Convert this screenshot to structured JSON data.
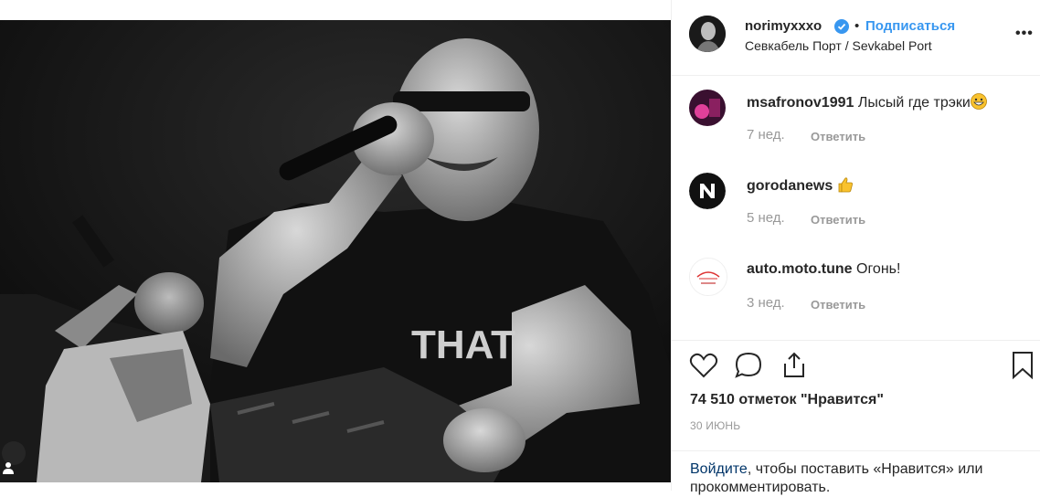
{
  "header": {
    "username": "norimyxxxo",
    "dot": "•",
    "follow_label": "Подписаться",
    "location": "Севкабель Порт / Sevkabel Port",
    "more_label": "•••"
  },
  "comments": [
    {
      "user": "msafronov1991",
      "text": "Лысый где трэки",
      "emoji": "grinning-face-icon",
      "age": "7 нед.",
      "reply": "Ответить"
    },
    {
      "user": "gorodanews",
      "text": "",
      "emoji": "thumbs-up-icon",
      "age": "5 нед.",
      "reply": "Ответить"
    },
    {
      "user": "auto.moto.tune",
      "text": "Огонь!",
      "emoji": "",
      "age": "3 нед.",
      "reply": "Ответить"
    }
  ],
  "actions": {
    "icons": [
      "heart-icon",
      "comment-icon",
      "share-icon",
      "bookmark-icon"
    ]
  },
  "likes": "74 510 отметок \"Нравится\"",
  "date": "30 ИЮНЬ",
  "login": {
    "link": "Войдите",
    "text": ", чтобы поставить «Нравится» или прокомментировать."
  },
  "colors": {
    "accent": "#3897f0",
    "text": "#262626",
    "muted": "#999999",
    "link": "#003569"
  }
}
